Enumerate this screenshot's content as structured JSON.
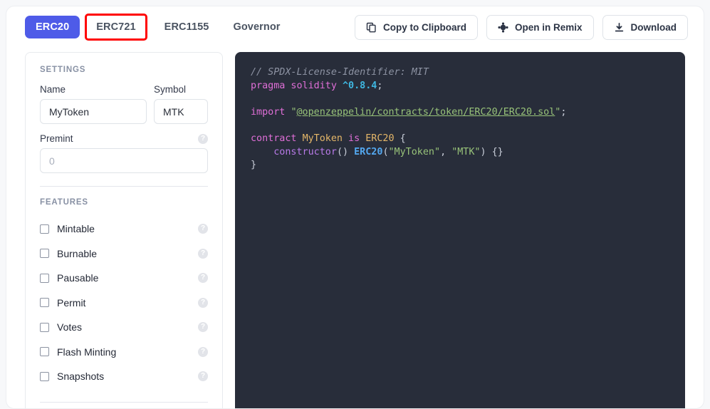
{
  "tabs": [
    {
      "id": "erc20",
      "label": "ERC20",
      "active": true,
      "highlighted": false
    },
    {
      "id": "erc721",
      "label": "ERC721",
      "active": false,
      "highlighted": true
    },
    {
      "id": "erc1155",
      "label": "ERC1155",
      "active": false,
      "highlighted": false
    },
    {
      "id": "governor",
      "label": "Governor",
      "active": false,
      "highlighted": false
    }
  ],
  "toolbar": {
    "copy_label": "Copy to Clipboard",
    "remix_label": "Open in Remix",
    "download_label": "Download"
  },
  "sidebar": {
    "settings_heading": "SETTINGS",
    "features_heading": "FEATURES",
    "help_glyph": "?",
    "fields": {
      "name": {
        "label": "Name",
        "value": "MyToken",
        "placeholder": "MyToken"
      },
      "symbol": {
        "label": "Symbol",
        "value": "MTK",
        "placeholder": "MTK"
      },
      "premint": {
        "label": "Premint",
        "value": "",
        "placeholder": "0"
      }
    },
    "features": [
      {
        "label": "Mintable",
        "checked": false
      },
      {
        "label": "Burnable",
        "checked": false
      },
      {
        "label": "Pausable",
        "checked": false
      },
      {
        "label": "Permit",
        "checked": false
      },
      {
        "label": "Votes",
        "checked": false
      },
      {
        "label": "Flash Minting",
        "checked": false
      },
      {
        "label": "Snapshots",
        "checked": false
      }
    ]
  },
  "editor": {
    "language": "solidity",
    "lines": {
      "license": "// SPDX-License-Identifier: MIT",
      "pragma_kw": "pragma solidity ",
      "pragma_version": "^0.8.4",
      "pragma_end": ";",
      "import_kw": "import ",
      "import_path": "@openzeppelin/contracts/token/ERC20/ERC20.sol",
      "contract_kw": "contract ",
      "contract_name": "MyToken",
      "is_kw": " is ",
      "base_name": "ERC20",
      "brace_open": " {",
      "constructor_name": "constructor",
      "constructor_args": "() ",
      "base_call": "ERC20",
      "ctor_str_name": "\"MyToken\"",
      "ctor_str_symbol": "\"MTK\"",
      "ctor_body": ") {}",
      "brace_close": "}"
    }
  },
  "colors": {
    "accent": "#4e5be8",
    "annotation": "#ff0000",
    "editor_bg": "#282d3a",
    "page_bg": "#f7f8fa"
  }
}
